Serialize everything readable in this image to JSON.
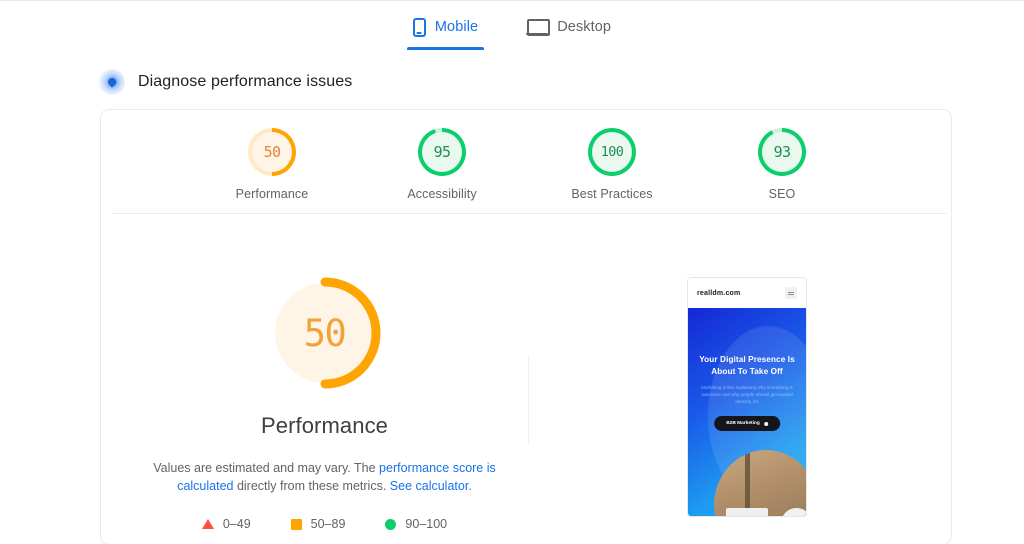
{
  "tabs": [
    {
      "id": "mobile",
      "label": "Mobile",
      "icon": "mobile-icon",
      "active": true
    },
    {
      "id": "desktop",
      "label": "Desktop",
      "icon": "desktop-icon",
      "active": false
    }
  ],
  "section": {
    "icon": "diagnose-gauge-icon",
    "title": "Diagnose performance issues"
  },
  "scores": [
    {
      "label": "Performance",
      "value": "50",
      "color": "#ffa400",
      "text_color": "#e8833a",
      "fill": "#fff5e7",
      "percent": 50
    },
    {
      "label": "Accessibility",
      "value": "95",
      "color": "#0cce6b",
      "text_color": "#1e8e53",
      "fill": "#e9f9f0",
      "percent": 95
    },
    {
      "label": "Best Practices",
      "value": "100",
      "color": "#0cce6b",
      "text_color": "#1e8e53",
      "fill": "#e9f9f0",
      "percent": 100
    },
    {
      "label": "SEO",
      "value": "93",
      "color": "#0cce6b",
      "text_color": "#1e8e53",
      "fill": "#e9f9f0",
      "percent": 93
    }
  ],
  "main_gauge": {
    "value": "50",
    "title": "Performance",
    "percent": 50,
    "arc_color": "#ffa400",
    "fill_color": "#fff5e7"
  },
  "disclaimer": {
    "part1": "Values are estimated and may vary. The ",
    "link1": "performance score is calculated",
    "part2": " directly from these metrics. ",
    "link2": "See calculator",
    "part3": "."
  },
  "legend": [
    {
      "shape": "triangle",
      "color": "#ff4e42",
      "range": "0–49"
    },
    {
      "shape": "square",
      "color": "#ffa400",
      "range": "50–89"
    },
    {
      "shape": "circle",
      "color": "#0cce6b",
      "range": "90–100"
    }
  ],
  "preview": {
    "domain": "realldm.com",
    "menu_icon": "hamburger-icon",
    "hero_title": "Your Digital Presence Is About To Take Off",
    "hero_subtitle": "Marketing is like explaining why something is awesome and why people should get excited about it, inc",
    "cta_label": "B2B Marketing"
  }
}
